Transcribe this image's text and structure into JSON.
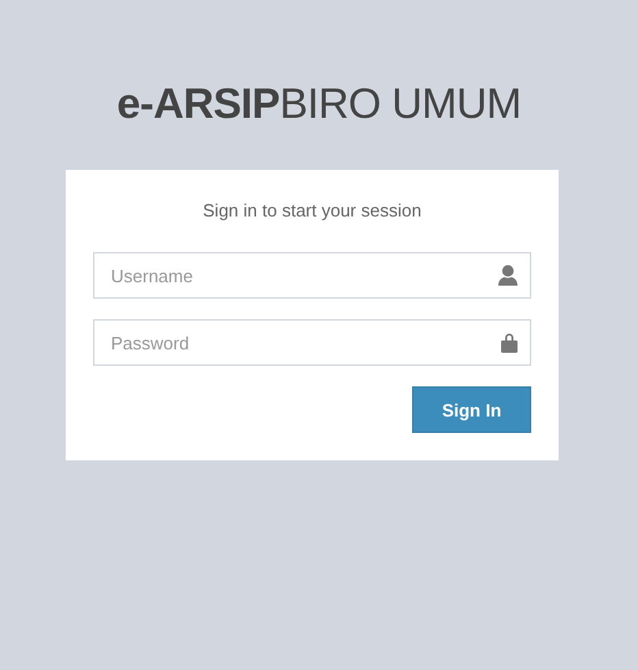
{
  "logo": "**e-ARSIP**BIRO UMUM",
  "login_box": {
    "message": "Sign in to start your session",
    "fields": [
      {
        "kind": "username",
        "placeholder": "Username"
      },
      {
        "kind": "password",
        "placeholder": "Password"
      }
    ],
    "button": "Sign In"
  }
}
